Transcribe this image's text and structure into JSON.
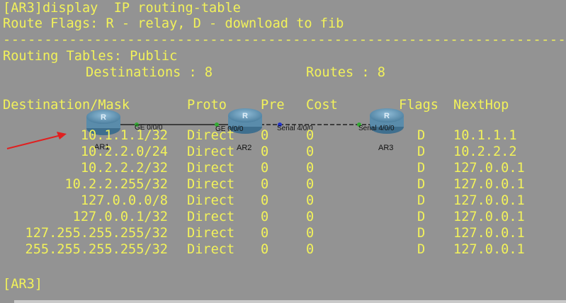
{
  "terminal": {
    "command_line": "[AR3]display  IP routing-table",
    "flags_line": "Route Flags: R - relay, D - download to fib",
    "separator": "------------------------------------------------------------------------------",
    "tables_line": "Routing Tables: Public",
    "destinations_label": "Destinations : 8",
    "routes_label": "Routes : 8",
    "headers": {
      "dest": "Destination/Mask",
      "proto": "Proto",
      "pre": "Pre",
      "cost": "Cost",
      "flags": "Flags",
      "nexthop": "NextHop"
    },
    "routes": [
      {
        "dest": "10.1.1.1/32",
        "proto": "Direct",
        "pre": "0",
        "cost": "0",
        "flags": "D",
        "nexthop": "10.1.1.1"
      },
      {
        "dest": "10.2.2.0/24",
        "proto": "Direct",
        "pre": "0",
        "cost": "0",
        "flags": "D",
        "nexthop": "10.2.2.2"
      },
      {
        "dest": "10.2.2.2/32",
        "proto": "Direct",
        "pre": "0",
        "cost": "0",
        "flags": "D",
        "nexthop": "127.0.0.1"
      },
      {
        "dest": "10.2.2.255/32",
        "proto": "Direct",
        "pre": "0",
        "cost": "0",
        "flags": "D",
        "nexthop": "127.0.0.1"
      },
      {
        "dest": "127.0.0.0/8",
        "proto": "Direct",
        "pre": "0",
        "cost": "0",
        "flags": "D",
        "nexthop": "127.0.0.1"
      },
      {
        "dest": "127.0.0.1/32",
        "proto": "Direct",
        "pre": "0",
        "cost": "0",
        "flags": "D",
        "nexthop": "127.0.0.1"
      },
      {
        "dest": "127.255.255.255/32",
        "proto": "Direct",
        "pre": "0",
        "cost": "0",
        "flags": "D",
        "nexthop": "127.0.0.1"
      },
      {
        "dest": "255.255.255.255/32",
        "proto": "Direct",
        "pre": "0",
        "cost": "0",
        "flags": "D",
        "nexthop": "127.0.0.1"
      }
    ],
    "prompt": "[AR3]"
  },
  "topology": {
    "routers": [
      {
        "label": "AR1",
        "icon": "router-icon"
      },
      {
        "label": "AR2",
        "icon": "router-icon"
      },
      {
        "label": "AR3",
        "icon": "router-icon"
      }
    ],
    "interfaces": {
      "ar1_ge": "GE 0/0/0",
      "ar2_ge": "GE 0/0/0",
      "ar2_serial": "Serial 4/0/0",
      "ar3_serial": "Serial 4/0/0"
    }
  },
  "colors": {
    "background": "#939393",
    "terminal_text": "#f2f25a",
    "annotation_arrow": "#e02020"
  }
}
